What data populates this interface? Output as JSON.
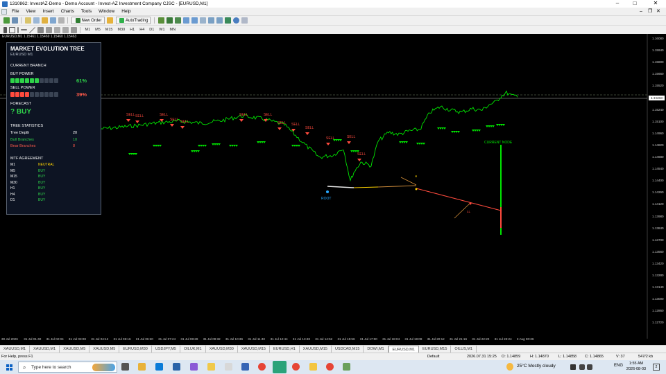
{
  "window": {
    "title": "1310862: InvestAZ-Demo - Demo Account - Invest-AZ Investment Company CJSC - [EURUSD,M1]"
  },
  "menu": [
    "File",
    "View",
    "Insert",
    "Charts",
    "Tools",
    "Window",
    "Help"
  ],
  "toolbar": {
    "new_order": "New Order",
    "auto_trading": "AutoTrading"
  },
  "timeframes": [
    "M1",
    "M5",
    "M15",
    "M30",
    "H1",
    "H4",
    "D1",
    "W1",
    "MN"
  ],
  "chart_header": "EURUSD,M1 1.15461 1.15469 1.15460 1.15463",
  "panel": {
    "title": "MARKET EVOLUTION TREE",
    "subtitle": "EURUSD  M1",
    "current_branch": "CURRENT BRANCH",
    "buy_label": "BUY POWER",
    "buy_pct": "61%",
    "buy_fill": 0.6,
    "sell_label": "SELL POWER",
    "sell_pct": "39%",
    "sell_fill": 0.4,
    "forecast_label": "FORECAST",
    "forecast_value": "? BUY",
    "stats_title": "TREE STATISTICS",
    "stats": [
      {
        "k": "Tree Depth",
        "v": "20"
      },
      {
        "k": "Bull Branches",
        "v": "10"
      },
      {
        "k": "Bear Branches",
        "v": "8"
      }
    ],
    "mtf_title": "MTF AGREEMENT",
    "mtf": [
      {
        "k": "M1",
        "v": "NEUTRAL"
      },
      {
        "k": "M5",
        "v": "BUY"
      },
      {
        "k": "M15",
        "v": "BUY"
      },
      {
        "k": "M30",
        "v": "BUY"
      },
      {
        "k": "H1",
        "v": "BUY"
      },
      {
        "k": "H4",
        "v": "BUY"
      },
      {
        "k": "D1",
        "v": "BUY"
      }
    ]
  },
  "annotations": {
    "root": "ROOT",
    "current_node": "CURRENT NODE",
    "hh": "H",
    "ll": "LL",
    "sell": "SELL"
  },
  "price_axis": [
    "1.16080",
    "1.15940",
    "1.15800",
    "1.15660",
    "1.15520",
    "1.15380",
    "1.15240",
    "1.15100",
    "1.14960",
    "1.14820",
    "1.14680",
    "1.14540",
    "1.14400",
    "1.14260",
    "1.14120",
    "1.13980",
    "1.13840",
    "1.13700",
    "1.13560",
    "1.13420",
    "1.13280",
    "1.13140",
    "1.13000",
    "1.12860",
    "1.12720"
  ],
  "current_price": "1.15463",
  "time_axis": [
    "30 Jul 2026",
    "31 Jul 01:40",
    "31 Jul 02:04",
    "31 Jul 03:08",
    "31 Jul 04:12",
    "31 Jul 05:16",
    "31 Jul 06:20",
    "31 Jul 07:24",
    "31 Jul 08:28",
    "31 Jul 09:32",
    "31 Jul 10:36",
    "31 Jul 11:40",
    "31 Jul 12:44",
    "31 Jul 13:48",
    "31 Jul 14:52",
    "31 Jul 15:56",
    "31 Jul 17:00",
    "31 Jul 18:04",
    "31 Jul 19:08",
    "31 Jul 20:12",
    "31 Jul 21:16",
    "31 Jul 22:20",
    "31 Jul 23:24",
    "3 Aug 00:36"
  ],
  "tabs": [
    "XAUUSD,M1",
    "XAUUSD,M1",
    "XAUUSD,M5",
    "XAUUSD,M5",
    "EURUSD,M30",
    "USDJPY,M5",
    "OILUK,M1",
    "XAUUSD,M30",
    "XAUUSD,M15",
    "EURUSD,H1",
    "XAUUSD,M15",
    "USDCAD,M15",
    "DOWI,M1",
    "EURUSD,M1",
    "EURUSD,M15",
    "OILUS,M1"
  ],
  "active_tab": 13,
  "status": {
    "help": "For Help, press F1",
    "profile": "Default",
    "time": "2026.07.31 15:25",
    "open": "O: 1.14859",
    "high": "H: 1.14870",
    "low": "L: 1.14858",
    "close": "C: 1.14865",
    "volume": "V: 37",
    "traffic": "547/2 kb"
  },
  "taskbar": {
    "search_placeholder": "Type here to search",
    "weather": "25°C  Mostly cloudy",
    "lang": "ENG",
    "time": "1:55 AM",
    "date": "2026-08-03",
    "notifications": "2"
  },
  "colors": {
    "bull": "#00e600",
    "bear": "#ff4b3e",
    "panel_bg": "#0d1423",
    "neutral": "#ffd400"
  }
}
